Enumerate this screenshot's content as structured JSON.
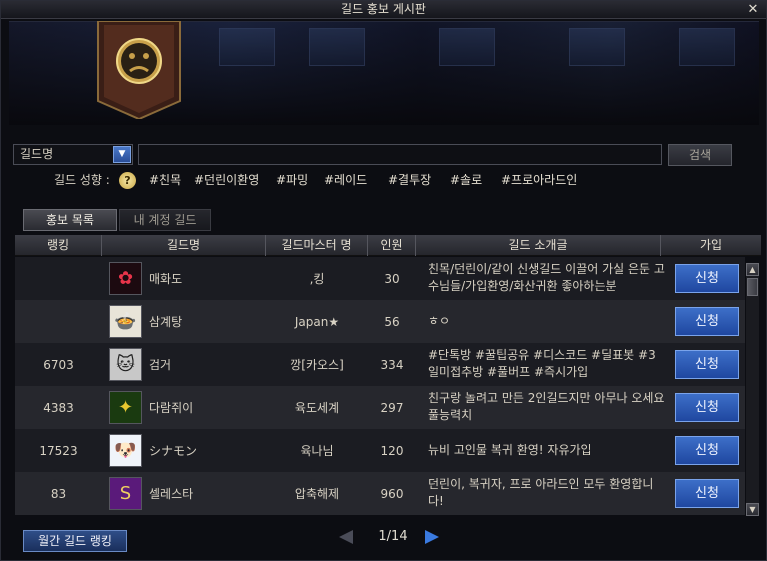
{
  "window": {
    "title": "길드 홍보 게시판",
    "close_glyph": "✕"
  },
  "search": {
    "select_value": "길드명",
    "input_value": "",
    "button_label": "검색"
  },
  "tags": {
    "label": "길드 성향 :",
    "items": [
      "#친목",
      "#던린이환영",
      "#파밍",
      "#레이드",
      "#결투장",
      "#솔로",
      "#프로아라드인"
    ]
  },
  "tabs": [
    {
      "label": "홍보 목록",
      "active": true
    },
    {
      "label": "내 계정 길드",
      "active": false
    }
  ],
  "table": {
    "headers": [
      "랭킹",
      "길드명",
      "길드마스터 명",
      "인원",
      "길드 소개글",
      "가입"
    ],
    "rows": [
      {
        "rank": "",
        "avatar_icon": "red-swirl-emblem-icon",
        "avatar_glyph": "✿",
        "avatar_bg": "#1c0a10",
        "avatar_fg": "#e8344a",
        "name": "매화도",
        "master": ",킹",
        "members": "30",
        "intro": "친목/던린이/같이 신생길드 이끌어 가실 은둔 고수님들/가입환영/화산귀환 좋아하는분",
        "join_label": "신청"
      },
      {
        "rank": "",
        "avatar_icon": "chicken-soup-bowl-icon",
        "avatar_glyph": "🍲",
        "avatar_bg": "#e8e4d8",
        "avatar_fg": "#b83a2a",
        "name": "삼계탕",
        "master": "Japan★",
        "members": "56",
        "intro": "ㅎㅇ",
        "join_label": "신청"
      },
      {
        "rank": "6703",
        "avatar_icon": "cat-face-icon",
        "avatar_glyph": "🐱",
        "avatar_bg": "#c8c8c8",
        "avatar_fg": "#222222",
        "name": "검거",
        "master": "깡[카오스]",
        "members": "334",
        "intro": "#단톡방 #꿀팁공유 #디스코드 #딜표봇 #3일미접추방 #풀버프 #즉시가입",
        "join_label": "신청"
      },
      {
        "rank": "4383",
        "avatar_icon": "green-eagle-emblem-icon",
        "avatar_glyph": "✦",
        "avatar_bg": "#1a3a10",
        "avatar_fg": "#e8c830",
        "name": "다람쥐이",
        "master": "육도세계",
        "members": "297",
        "intro": "친구랑 놀려고 만든 2인길드지만 아무나 오세요 풀능력치",
        "join_label": "신청"
      },
      {
        "rank": "17523",
        "avatar_icon": "white-puppy-icon",
        "avatar_glyph": "🐶",
        "avatar_bg": "#f0f4fa",
        "avatar_fg": "#6a9ad8",
        "name": "シナモン",
        "master": "육나님",
        "members": "120",
        "intro": "뉴비 고인물 복귀 환영! 자유가입",
        "join_label": "신청"
      },
      {
        "rank": "83",
        "avatar_icon": "purple-s-emblem-icon",
        "avatar_glyph": "S",
        "avatar_bg": "#5a1a7a",
        "avatar_fg": "#f0d060",
        "name": "셀레스타",
        "master": "압축해제",
        "members": "960",
        "intro": "던린이, 복귀자, 프로 아라드인 모두 환영합니다!",
        "join_label": "신청"
      }
    ]
  },
  "footer": {
    "monthly_ranking_label": "월간 길드 랭킹",
    "page_text": "1/14"
  }
}
